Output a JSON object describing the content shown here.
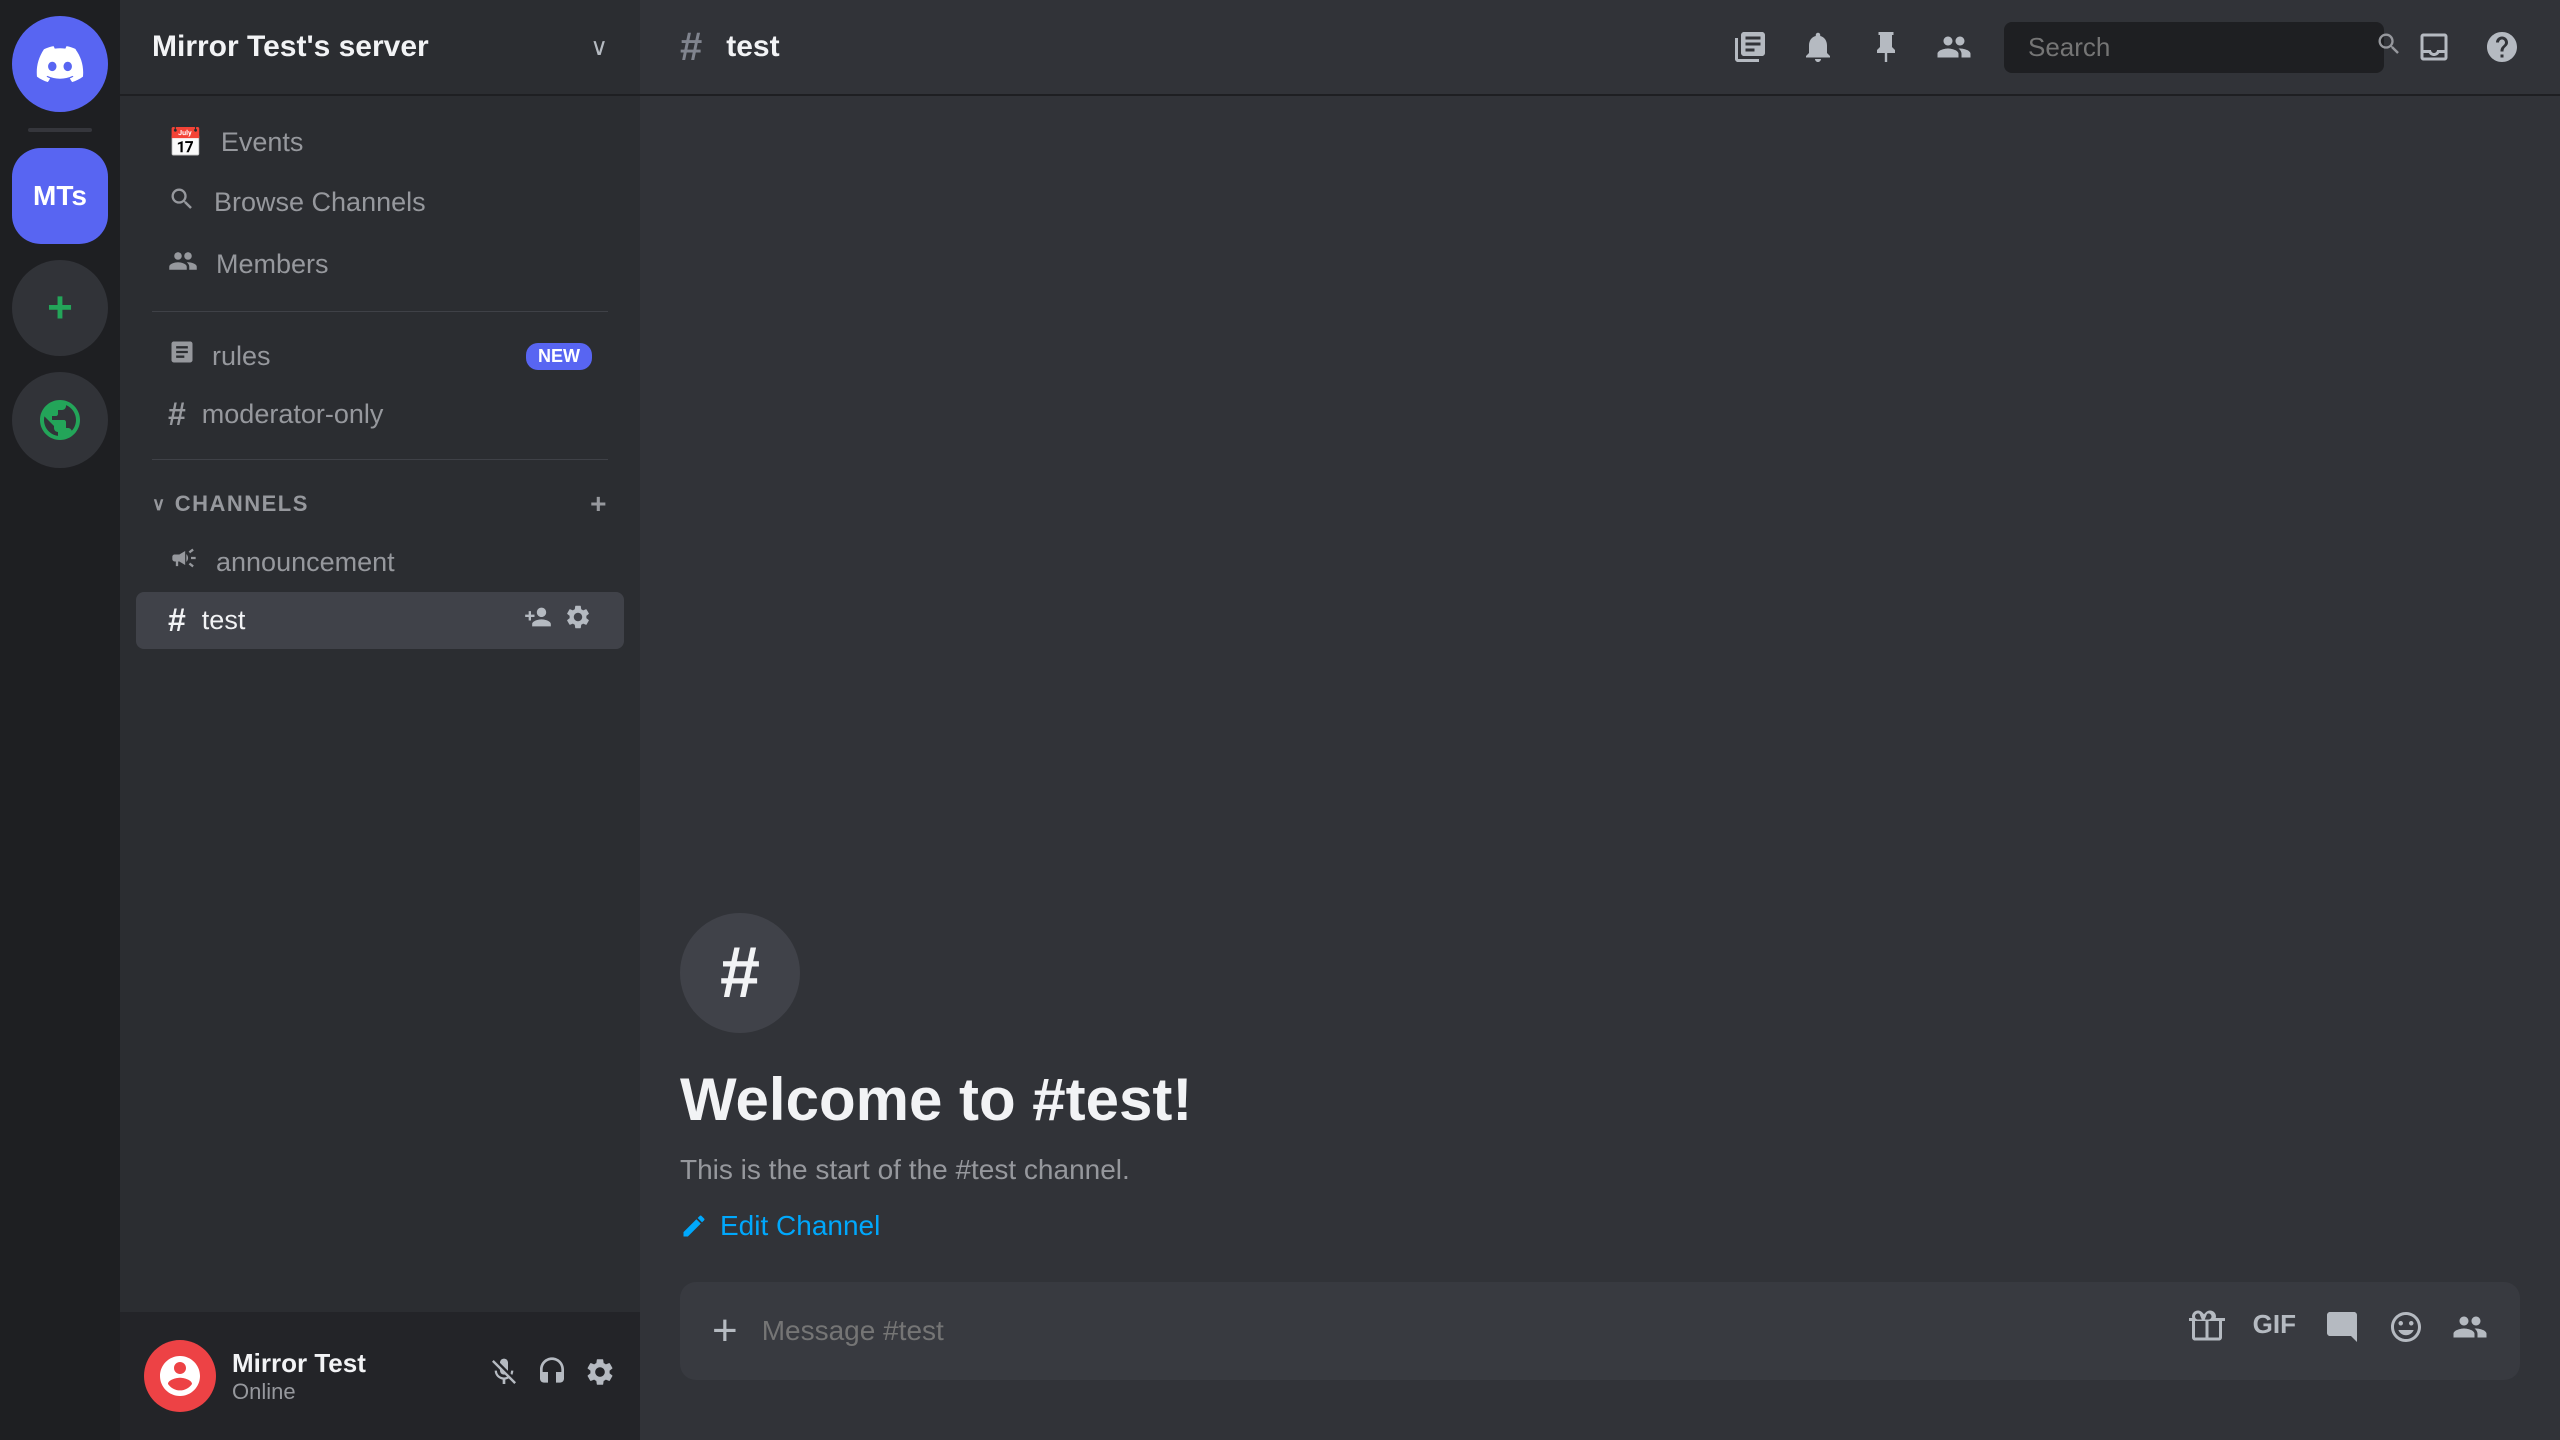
{
  "server_sidebar": {
    "discord_icon": "🎮",
    "server_abbreviation": "MTs",
    "add_label": "+",
    "explore_label": "🧭"
  },
  "channel_sidebar": {
    "server_name": "Mirror Test's server",
    "chevron": "∨",
    "nav_items": [
      {
        "id": "events",
        "label": "Events",
        "icon": "📅"
      },
      {
        "id": "browse-channels",
        "label": "Browse Channels",
        "icon": "🔍"
      },
      {
        "id": "members",
        "label": "Members",
        "icon": "👥"
      }
    ],
    "standalone_channels": [
      {
        "id": "rules",
        "label": "rules",
        "icon": "📋",
        "badge": "NEW"
      },
      {
        "id": "moderator-only",
        "label": "moderator-only",
        "icon": "#"
      }
    ],
    "categories": [
      {
        "id": "channels",
        "label": "CHANNELS",
        "channels": [
          {
            "id": "announcement",
            "label": "announcement",
            "icon": "📢",
            "active": false
          },
          {
            "id": "test",
            "label": "test",
            "icon": "#",
            "active": true,
            "has_actions": true
          }
        ]
      }
    ]
  },
  "user_panel": {
    "username": "Mirror Test",
    "status": "Online",
    "avatar_initial": "🔴"
  },
  "top_bar": {
    "channel_icon": "#",
    "channel_name": "test",
    "search_placeholder": "Search"
  },
  "chat_area": {
    "welcome_icon": "#",
    "welcome_title": "Welcome to #test!",
    "welcome_desc": "This is the start of the #test channel.",
    "edit_channel_label": "Edit Channel"
  },
  "message_bar": {
    "placeholder": "Message #test"
  }
}
